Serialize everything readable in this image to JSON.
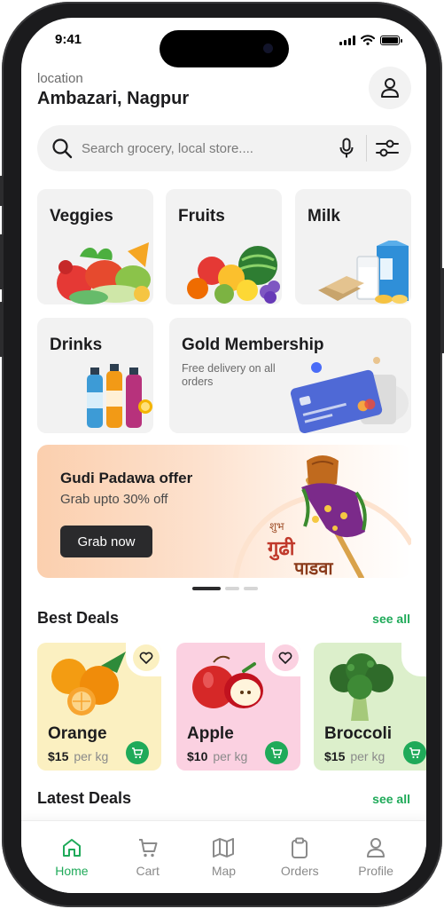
{
  "status_bar": {
    "time": "9:41"
  },
  "header": {
    "location_label": "location",
    "location_value": "Ambazari, Nagpur"
  },
  "search": {
    "placeholder": "Search grocery, local store...."
  },
  "categories": [
    {
      "label": "Veggies"
    },
    {
      "label": "Fruits"
    },
    {
      "label": "Milk"
    },
    {
      "label": "Drinks"
    },
    {
      "label": "Gold Membership",
      "subtitle": "Free delivery on all orders"
    }
  ],
  "banner": {
    "title": "Gudi Padawa offer",
    "subtitle": "Grab upto 30% off",
    "button_label": "Grab now",
    "decor_text_1": "शुभ",
    "decor_text_2": "गुढी",
    "decor_text_3": "पाडवा"
  },
  "best_deals": {
    "title": "Best Deals",
    "see_all": "see all",
    "items": [
      {
        "name": "Orange",
        "price": "$15",
        "unit": "per kg",
        "bg": "#fbf0c1"
      },
      {
        "name": "Apple",
        "price": "$10",
        "unit": "per kg",
        "bg": "#fbd1e1"
      },
      {
        "name": "Broccoli",
        "price": "$15",
        "unit": "per kg",
        "bg": "#dcefcb"
      }
    ]
  },
  "latest_deals": {
    "title": "Latest Deals",
    "see_all": "see all"
  },
  "bottom_nav": {
    "items": [
      {
        "label": "Home",
        "icon": "home-icon",
        "active": true
      },
      {
        "label": "Cart",
        "icon": "cart-icon"
      },
      {
        "label": "Map",
        "icon": "map-icon"
      },
      {
        "label": "Orders",
        "icon": "clipboard-icon"
      },
      {
        "label": "Profile",
        "icon": "user-icon"
      }
    ]
  },
  "colors": {
    "accent": "#1faa59",
    "card_bg": "#f2f2f2",
    "dark_button": "#2a2a2c"
  }
}
